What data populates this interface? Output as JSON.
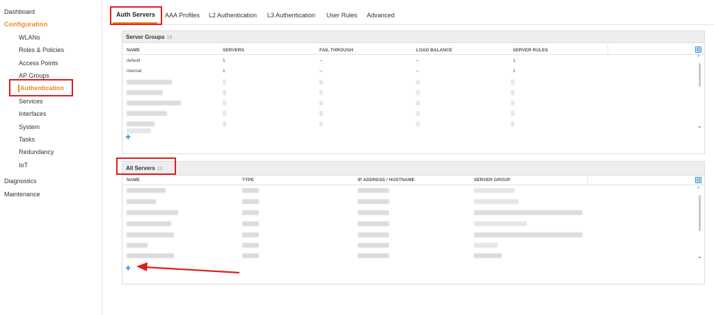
{
  "sidebar": {
    "dashboard": "Dashboard",
    "configuration": "Configuration",
    "items": [
      {
        "label": "WLANs"
      },
      {
        "label": "Roles & Policies"
      },
      {
        "label": "Access Points"
      },
      {
        "label": "AP Groups"
      },
      {
        "label": "Authentication"
      },
      {
        "label": "Services"
      },
      {
        "label": "Interfaces"
      },
      {
        "label": "System"
      },
      {
        "label": "Tasks"
      },
      {
        "label": "Redundancy"
      },
      {
        "label": "IoT"
      }
    ],
    "diagnostics": "Diagnostics",
    "maintenance": "Maintenance"
  },
  "tabs": [
    {
      "label": "Auth Servers"
    },
    {
      "label": "AAA Profiles"
    },
    {
      "label": "L2 Authentication"
    },
    {
      "label": "L3 Authentication"
    },
    {
      "label": "User Rules"
    },
    {
      "label": "Advanced"
    }
  ],
  "server_groups": {
    "title": "Server Groups",
    "count": "19",
    "columns": [
      "NAME",
      "SERVERS",
      "FAIL THROUGH",
      "LOAD BALANCE",
      "SERVER RULES"
    ],
    "rows": [
      {
        "name": "default",
        "servers": "1",
        "fail_through": "--",
        "load_balance": "--",
        "server_rules": "1"
      },
      {
        "name": "internal",
        "servers": "1",
        "fail_through": "--",
        "load_balance": "--",
        "server_rules": "1"
      }
    ],
    "add_icon": "+"
  },
  "all_servers": {
    "title": "All Servers",
    "count": "12",
    "columns": [
      "NAME",
      "TYPE",
      "IP ADDRESS / HOSTNAME",
      "SERVER GROUP"
    ],
    "add_icon": "+"
  },
  "icons": {
    "scroll_up": "^",
    "chevron_down": "⌄"
  },
  "colors": {
    "accent": "#f08a24",
    "annotation_red": "#e01b1b",
    "add_blue": "#1e88d2",
    "header_bg": "#eceef0"
  }
}
